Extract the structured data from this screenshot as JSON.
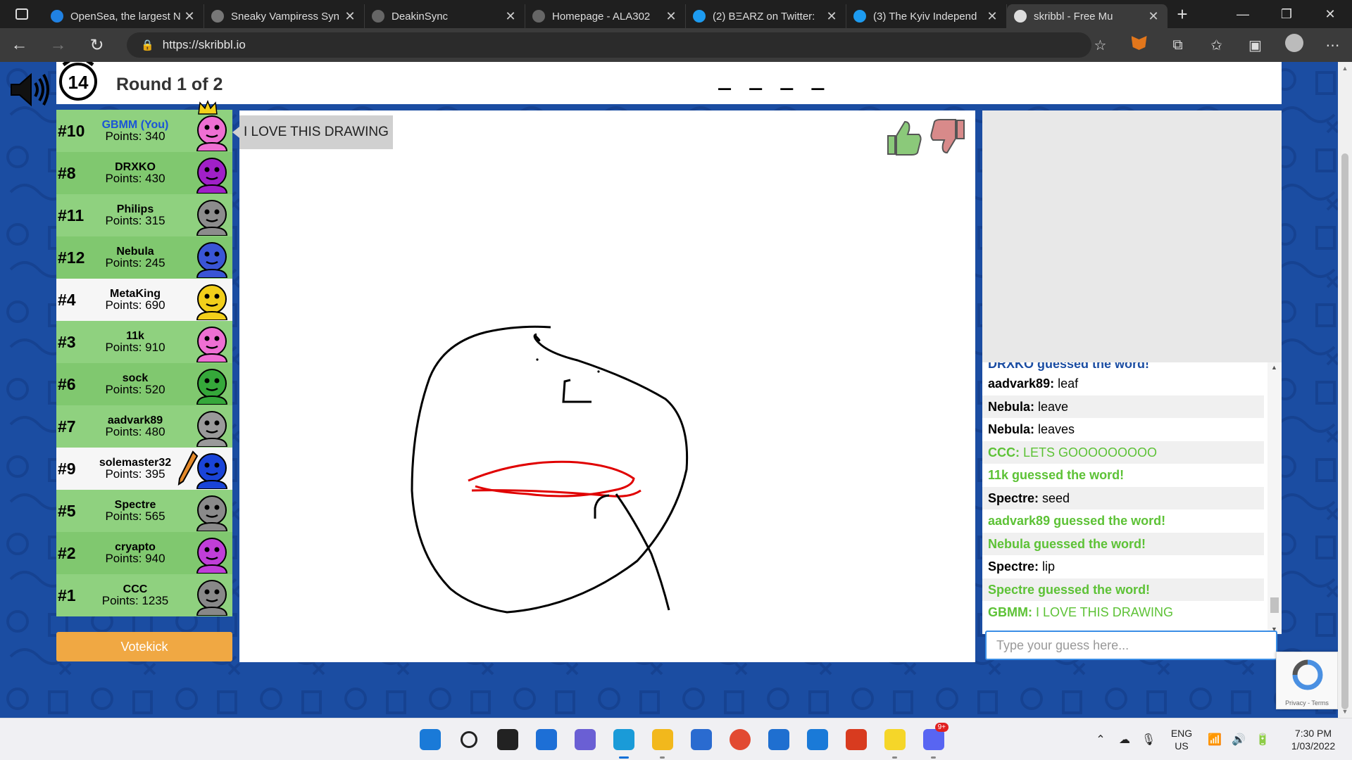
{
  "browser": {
    "tabs": [
      {
        "title": "OpenSea, the largest N",
        "color": "#2081e2"
      },
      {
        "title": "Sneaky Vampiress Syn",
        "color": "#777777"
      },
      {
        "title": "DeakinSync",
        "color": "#666666"
      },
      {
        "title": "Homepage - ALA302",
        "color": "#666666"
      },
      {
        "title": "(2) BΞARZ on Twitter:",
        "color": "#1d9bf0"
      },
      {
        "title": "(3) The Kyiv Independ",
        "color": "#1d9bf0"
      },
      {
        "title": "skribbl - Free Mu",
        "color": "#dddddd"
      }
    ],
    "url": "https://skribbl.io"
  },
  "game": {
    "timer": "14",
    "round": "Round 1 of 2",
    "word_hint": "_ _ _ _",
    "speech_bubble": "I LOVE THIS DRAWING",
    "votekick": "Votekick",
    "guess_placeholder": "Type your guess here...",
    "recaptcha_text": "Privacy - Terms"
  },
  "players": [
    {
      "rank": "#10",
      "name": "GBMM (You)",
      "points": "Points: 340",
      "color": "#ee6fd3",
      "bg": "odd",
      "you": true
    },
    {
      "rank": "#8",
      "name": "DRXKO",
      "points": "Points: 430",
      "color": "#a020c8",
      "bg": "even"
    },
    {
      "rank": "#11",
      "name": "Philips",
      "points": "Points: 315",
      "color": "#8c8c8c",
      "bg": "odd"
    },
    {
      "rank": "#12",
      "name": "Nebula",
      "points": "Points: 245",
      "color": "#3a55d6",
      "bg": "even"
    },
    {
      "rank": "#4",
      "name": "MetaKing",
      "points": "Points: 690",
      "color": "#f2cf1a",
      "bg": "white"
    },
    {
      "rank": "#3",
      "name": "11k",
      "points": "Points: 910",
      "color": "#ee6fd3",
      "bg": "odd"
    },
    {
      "rank": "#6",
      "name": "sock",
      "points": "Points: 520",
      "color": "#35a83a",
      "bg": "even"
    },
    {
      "rank": "#7",
      "name": "aadvark89",
      "points": "Points: 480",
      "color": "#9a9a9a",
      "bg": "odd"
    },
    {
      "rank": "#9",
      "name": "solemaster32",
      "points": "Points: 395",
      "color": "#1a44d8",
      "bg": "white"
    },
    {
      "rank": "#5",
      "name": "Spectre",
      "points": "Points: 565",
      "color": "#8a8a8a",
      "bg": "odd"
    },
    {
      "rank": "#2",
      "name": "cryapto",
      "points": "Points: 940",
      "color": "#c03ed8",
      "bg": "even"
    },
    {
      "rank": "#1",
      "name": "CCC",
      "points": "Points: 1235",
      "color": "#888888",
      "bg": "odd"
    }
  ],
  "chat": {
    "partial": "DRXKO guessed the word!",
    "messages": [
      {
        "who": "aadvark89:",
        "body": " leaf",
        "type": "normal"
      },
      {
        "who": "Nebula:",
        "body": " leave",
        "type": "normal"
      },
      {
        "who": "Nebula:",
        "body": " leaves",
        "type": "normal"
      },
      {
        "who": "CCC:",
        "body": " LETS GOOOOOOOOO",
        "type": "green"
      },
      {
        "who": "",
        "body": "11k guessed the word!",
        "type": "green-full"
      },
      {
        "who": "Spectre:",
        "body": " seed",
        "type": "normal"
      },
      {
        "who": "",
        "body": "aadvark89 guessed the word!",
        "type": "green-full"
      },
      {
        "who": "",
        "body": "Nebula guessed the word!",
        "type": "green-full"
      },
      {
        "who": "Spectre:",
        "body": " lip",
        "type": "normal"
      },
      {
        "who": "",
        "body": "Spectre guessed the word!",
        "type": "green-full"
      },
      {
        "who": "GBMM:",
        "body": " I LOVE THIS DRAWING",
        "type": "green"
      }
    ]
  },
  "taskbar": {
    "lang_top": "ENG",
    "lang_bottom": "US",
    "time": "7:30 PM",
    "date": "1/03/2022",
    "discord_badge": "9+",
    "apps": [
      {
        "name": "windows-start-icon",
        "color": "#1a7ad8"
      },
      {
        "name": "search-icon",
        "color": "#222222"
      },
      {
        "name": "task-view-icon",
        "color": "#222222"
      },
      {
        "name": "widgets-icon",
        "color": "#1d6fd6"
      },
      {
        "name": "teams-chat-icon",
        "color": "#6a5fd4"
      },
      {
        "name": "edge-icon",
        "color": "#1a9bd8"
      },
      {
        "name": "file-explorer-icon",
        "color": "#f2b81c"
      },
      {
        "name": "store-icon",
        "color": "#2a6bd0"
      },
      {
        "name": "chrome-icon",
        "color": "#e24a32"
      },
      {
        "name": "mail-icon",
        "color": "#1f6fd0"
      },
      {
        "name": "dell-icon",
        "color": "#1a7ad8"
      },
      {
        "name": "office-icon",
        "color": "#d83b1f"
      },
      {
        "name": "sticky-notes-icon",
        "color": "#f5d629"
      },
      {
        "name": "discord-icon",
        "color": "#5865f2"
      }
    ]
  }
}
